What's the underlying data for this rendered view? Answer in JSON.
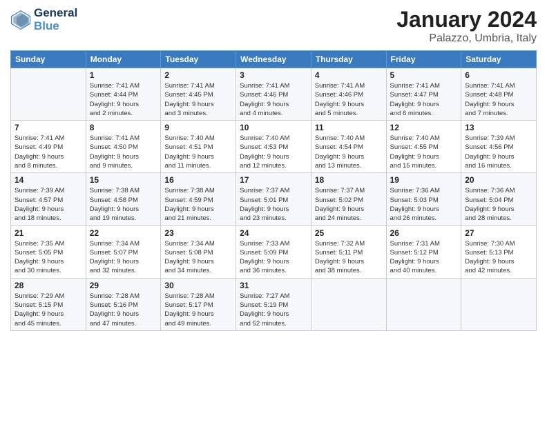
{
  "header": {
    "logo_line1": "General",
    "logo_line2": "Blue",
    "main_title": "January 2024",
    "subtitle": "Palazzo, Umbria, Italy"
  },
  "columns": [
    "Sunday",
    "Monday",
    "Tuesday",
    "Wednesday",
    "Thursday",
    "Friday",
    "Saturday"
  ],
  "weeks": [
    [
      {
        "day": "",
        "info": ""
      },
      {
        "day": "1",
        "info": "Sunrise: 7:41 AM\nSunset: 4:44 PM\nDaylight: 9 hours\nand 2 minutes."
      },
      {
        "day": "2",
        "info": "Sunrise: 7:41 AM\nSunset: 4:45 PM\nDaylight: 9 hours\nand 3 minutes."
      },
      {
        "day": "3",
        "info": "Sunrise: 7:41 AM\nSunset: 4:46 PM\nDaylight: 9 hours\nand 4 minutes."
      },
      {
        "day": "4",
        "info": "Sunrise: 7:41 AM\nSunset: 4:46 PM\nDaylight: 9 hours\nand 5 minutes."
      },
      {
        "day": "5",
        "info": "Sunrise: 7:41 AM\nSunset: 4:47 PM\nDaylight: 9 hours\nand 6 minutes."
      },
      {
        "day": "6",
        "info": "Sunrise: 7:41 AM\nSunset: 4:48 PM\nDaylight: 9 hours\nand 7 minutes."
      }
    ],
    [
      {
        "day": "7",
        "info": "Sunrise: 7:41 AM\nSunset: 4:49 PM\nDaylight: 9 hours\nand 8 minutes."
      },
      {
        "day": "8",
        "info": "Sunrise: 7:41 AM\nSunset: 4:50 PM\nDaylight: 9 hours\nand 9 minutes."
      },
      {
        "day": "9",
        "info": "Sunrise: 7:40 AM\nSunset: 4:51 PM\nDaylight: 9 hours\nand 11 minutes."
      },
      {
        "day": "10",
        "info": "Sunrise: 7:40 AM\nSunset: 4:53 PM\nDaylight: 9 hours\nand 12 minutes."
      },
      {
        "day": "11",
        "info": "Sunrise: 7:40 AM\nSunset: 4:54 PM\nDaylight: 9 hours\nand 13 minutes."
      },
      {
        "day": "12",
        "info": "Sunrise: 7:40 AM\nSunset: 4:55 PM\nDaylight: 9 hours\nand 15 minutes."
      },
      {
        "day": "13",
        "info": "Sunrise: 7:39 AM\nSunset: 4:56 PM\nDaylight: 9 hours\nand 16 minutes."
      }
    ],
    [
      {
        "day": "14",
        "info": "Sunrise: 7:39 AM\nSunset: 4:57 PM\nDaylight: 9 hours\nand 18 minutes."
      },
      {
        "day": "15",
        "info": "Sunrise: 7:38 AM\nSunset: 4:58 PM\nDaylight: 9 hours\nand 19 minutes."
      },
      {
        "day": "16",
        "info": "Sunrise: 7:38 AM\nSunset: 4:59 PM\nDaylight: 9 hours\nand 21 minutes."
      },
      {
        "day": "17",
        "info": "Sunrise: 7:37 AM\nSunset: 5:01 PM\nDaylight: 9 hours\nand 23 minutes."
      },
      {
        "day": "18",
        "info": "Sunrise: 7:37 AM\nSunset: 5:02 PM\nDaylight: 9 hours\nand 24 minutes."
      },
      {
        "day": "19",
        "info": "Sunrise: 7:36 AM\nSunset: 5:03 PM\nDaylight: 9 hours\nand 26 minutes."
      },
      {
        "day": "20",
        "info": "Sunrise: 7:36 AM\nSunset: 5:04 PM\nDaylight: 9 hours\nand 28 minutes."
      }
    ],
    [
      {
        "day": "21",
        "info": "Sunrise: 7:35 AM\nSunset: 5:05 PM\nDaylight: 9 hours\nand 30 minutes."
      },
      {
        "day": "22",
        "info": "Sunrise: 7:34 AM\nSunset: 5:07 PM\nDaylight: 9 hours\nand 32 minutes."
      },
      {
        "day": "23",
        "info": "Sunrise: 7:34 AM\nSunset: 5:08 PM\nDaylight: 9 hours\nand 34 minutes."
      },
      {
        "day": "24",
        "info": "Sunrise: 7:33 AM\nSunset: 5:09 PM\nDaylight: 9 hours\nand 36 minutes."
      },
      {
        "day": "25",
        "info": "Sunrise: 7:32 AM\nSunset: 5:11 PM\nDaylight: 9 hours\nand 38 minutes."
      },
      {
        "day": "26",
        "info": "Sunrise: 7:31 AM\nSunset: 5:12 PM\nDaylight: 9 hours\nand 40 minutes."
      },
      {
        "day": "27",
        "info": "Sunrise: 7:30 AM\nSunset: 5:13 PM\nDaylight: 9 hours\nand 42 minutes."
      }
    ],
    [
      {
        "day": "28",
        "info": "Sunrise: 7:29 AM\nSunset: 5:15 PM\nDaylight: 9 hours\nand 45 minutes."
      },
      {
        "day": "29",
        "info": "Sunrise: 7:28 AM\nSunset: 5:16 PM\nDaylight: 9 hours\nand 47 minutes."
      },
      {
        "day": "30",
        "info": "Sunrise: 7:28 AM\nSunset: 5:17 PM\nDaylight: 9 hours\nand 49 minutes."
      },
      {
        "day": "31",
        "info": "Sunrise: 7:27 AM\nSunset: 5:19 PM\nDaylight: 9 hours\nand 52 minutes."
      },
      {
        "day": "",
        "info": ""
      },
      {
        "day": "",
        "info": ""
      },
      {
        "day": "",
        "info": ""
      }
    ]
  ]
}
